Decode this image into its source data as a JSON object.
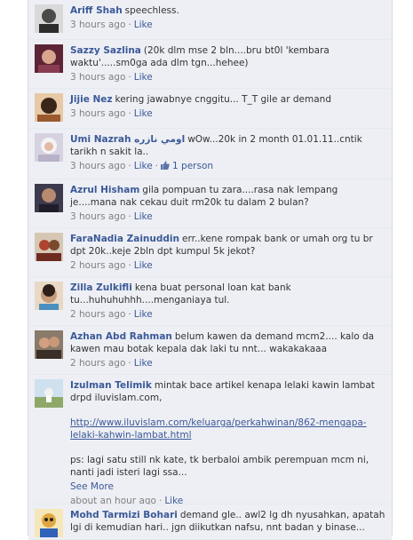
{
  "comments": [
    {
      "author": "Ariff Shah",
      "text": "speechless.",
      "time": "3 hours ago",
      "like": "Like",
      "avatar_color": "#6b6b6b"
    },
    {
      "author": "Sazzy Sazlina",
      "text": "(20k dlm mse 2 bln....bru bt0l 'kembara waktu'.....sm0ga ada dlm tgn...hehee)",
      "time": "3 hours ago",
      "like": "Like",
      "avatar_color": "#8a3c52"
    },
    {
      "author": "Jijie Nez",
      "text": "kering jawabnye cnggitu... T_T gile ar demand",
      "time": "3 hours ago",
      "like": "Like",
      "avatar_color": "#9a5a2e"
    },
    {
      "author": "Umi Nazrah اومي نازره",
      "text": "wOw...20k in 2 month 01.01.11..cntik tarikh n sakit la..",
      "time": "3 hours ago",
      "like": "Like",
      "likes_count": "1 person",
      "avatar_color": "#b8b1c8"
    },
    {
      "author": "Azrul Hisham",
      "text": "gila pompuan tu zara....rasa nak lempang je....mana nak cekau duit rm20k tu dalam 2 bulan?",
      "time": "3 hours ago",
      "like": "Like",
      "avatar_color": "#3d3a4e"
    },
    {
      "author": "FaraNadia Zainuddin",
      "text": "err..kene rompak bank or umah org tu br dpt 20k..keje 2bln dpt kumpul 5k jekot?",
      "time": "2 hours ago",
      "like": "Like",
      "avatar_color": "#b0432f"
    },
    {
      "author": "Zilla Zulkifli",
      "text": "kena buat personal loan kat bank tu...huhuhuhhh....menganiaya tul.",
      "time": "2 hours ago",
      "like": "Like",
      "avatar_color": "#c79a7a"
    },
    {
      "author": "Azhan Abd Rahman",
      "text": "belum kawen da demand mcm2.... kalo da kawen mau botak kepala dak laki tu nnt... wakakakaaa",
      "time": "2 hours ago",
      "like": "Like",
      "avatar_color": "#5a4638"
    },
    {
      "author": "Izulman Telimik",
      "text": "mintak bace artikel kenapa lelaki kawin lambat drpd iluvislam.com,",
      "link": "http://www.iluvislam.com/keluarga/perkahwinan/862-mengapa-lelaki-kahwin-lambat.html",
      "text2": "ps: lagi satu still nk kate, tk berbaloi ambik perempuan mcm ni, nanti jadi isteri lagi ssa...",
      "see_more": "See More",
      "time": "about an hour ago",
      "like": "Like",
      "avatar_color": "#8fa86a"
    },
    {
      "author": "Mohd Tarmizi Bohari",
      "text": "demand gle.. awl2 lg dh nyusahkan, apatah lgi di kemudian hari.. jgn diikutkan nafsu, nnt badan y binase...",
      "time": "",
      "like": "",
      "avatar_color": "#e0a640"
    }
  ]
}
